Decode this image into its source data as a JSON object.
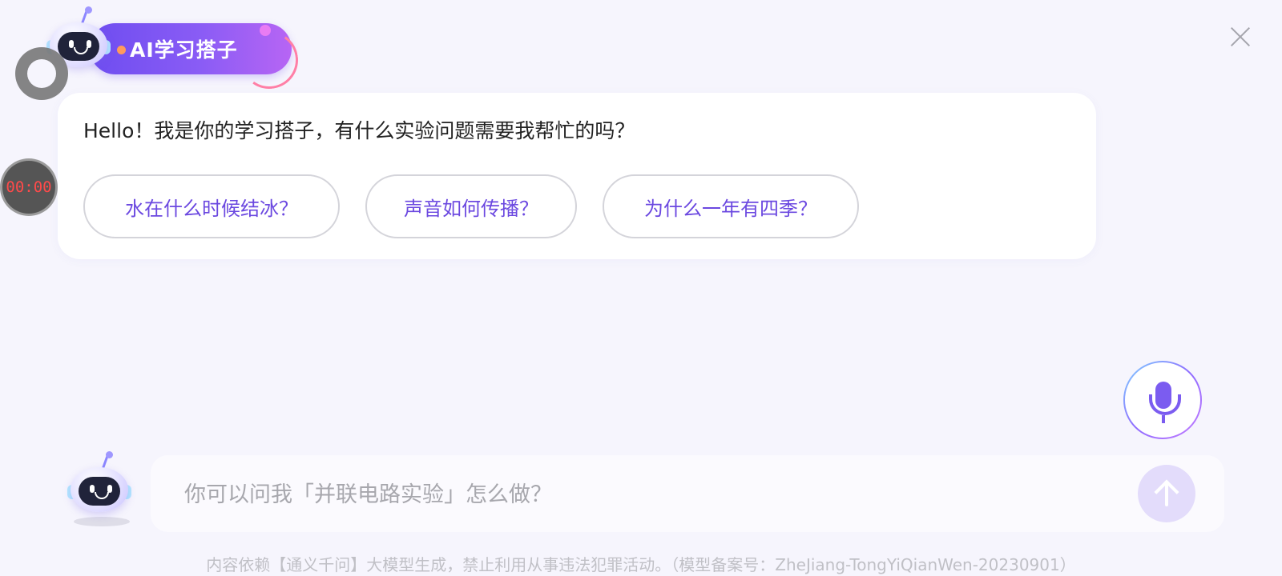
{
  "header": {
    "badge_label": "AI学习搭子",
    "close_icon": "close-icon"
  },
  "overlay": {
    "timer": "00:00"
  },
  "chat": {
    "greeting": "Hello！我是你的学习搭子，有什么实验问题需要我帮忙的吗？",
    "suggestions": [
      "水在什么时候结冰？",
      "声音如何传播？",
      "为什么一年有四季？"
    ]
  },
  "input": {
    "placeholder": "你可以问我「并联电路实验」怎么做？"
  },
  "footer": {
    "note": "内容依赖【通义千问】大模型生成，禁止利用从事违法犯罪活动。（模型备案号：ZheJiang-TongYiQianWen-20230901）"
  },
  "colors": {
    "accent": "#6b48e0",
    "background": "#f6f5fd",
    "badge_gradient_start": "#6e4df0",
    "badge_gradient_end": "#b765f4"
  }
}
